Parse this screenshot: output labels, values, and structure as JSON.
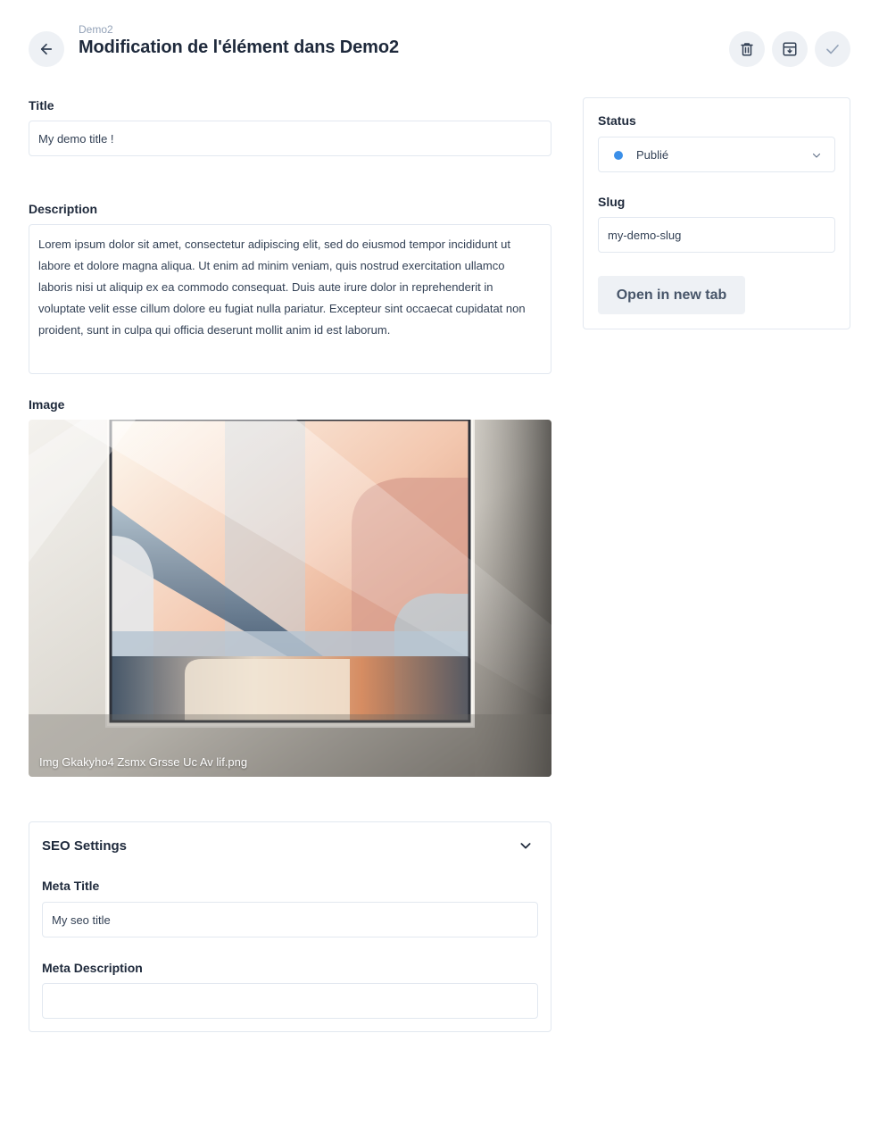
{
  "header": {
    "breadcrumb": "Demo2",
    "title": "Modification de l'élément dans Demo2",
    "back_icon": "arrow-left-icon",
    "actions": [
      {
        "name": "delete",
        "icon": "trash-icon"
      },
      {
        "name": "archive",
        "icon": "archive-icon"
      },
      {
        "name": "confirm",
        "icon": "check-icon"
      }
    ]
  },
  "form": {
    "title_label": "Title",
    "title_value": "My demo title !",
    "description_label": "Description",
    "description_value": "Lorem ipsum dolor sit amet, consectetur adipiscing elit, sed do eiusmod tempor incididunt ut labore et dolore magna aliqua. Ut enim ad minim veniam, quis nostrud exercitation ullamco laboris nisi ut aliquip ex ea commodo consequat. Duis aute irure dolor in reprehenderit in voluptate velit esse cillum dolore eu fugiat nulla pariatur. Excepteur sint occaecat cupidatat non proident, sunt in culpa qui officia deserunt mollit anim id est laborum.",
    "image_label": "Image",
    "image_filename": "Img Gkakyho4 Zsmx Grsse Uc Av lif.png"
  },
  "seo": {
    "section_title": "SEO Settings",
    "meta_title_label": "Meta Title",
    "meta_title_value": "My seo title",
    "meta_description_label": "Meta Description",
    "meta_description_value": ""
  },
  "sidebar": {
    "status_label": "Status",
    "status_value": "Publié",
    "status_color": "#3b8fe8",
    "slug_label": "Slug",
    "slug_value": "my-demo-slug",
    "open_tab_label": "Open in new tab"
  },
  "colors": {
    "accent_bg": "#eef1f5",
    "border": "#e2e8f0",
    "text": "#1e293b",
    "muted": "#94a3b8"
  }
}
